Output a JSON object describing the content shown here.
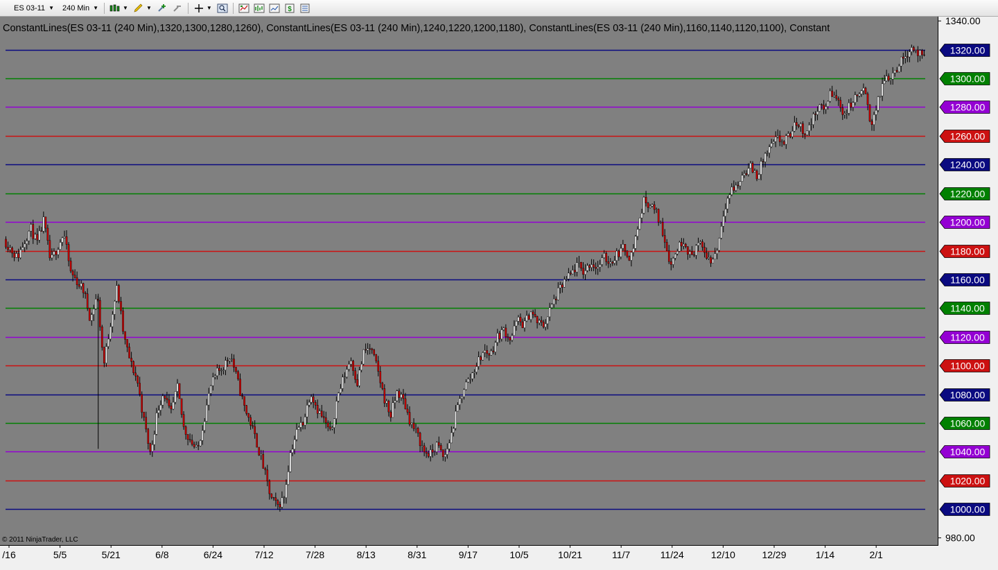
{
  "toolbar": {
    "instrument": "ES 03-11",
    "interval": "240 Min",
    "buttons": [
      {
        "name": "bar-type-icon",
        "dropdown": true
      },
      {
        "name": "draw-pencil-icon",
        "dropdown": true
      },
      {
        "name": "zoom-in-icon",
        "dropdown": false
      },
      {
        "name": "zoom-out-icon",
        "dropdown": false
      },
      {
        "name": "crosshair-icon",
        "dropdown": true
      },
      {
        "name": "magnify-icon",
        "dropdown": false
      },
      {
        "name": "strategies-icon",
        "dropdown": false
      },
      {
        "name": "indicators-icon",
        "dropdown": false
      },
      {
        "name": "data-box-icon",
        "dropdown": false
      },
      {
        "name": "dollar-icon",
        "dropdown": false
      },
      {
        "name": "properties-icon",
        "dropdown": false
      }
    ]
  },
  "chart": {
    "indicator_label": "ConstantLines(ES 03-11 (240 Min),1320,1300,1280,1260), ConstantLines(ES 03-11 (240 Min),1240,1220,1200,1180), ConstantLines(ES 03-11 (240 Min),1160,1140,1120,1100), Constant",
    "copyright": "© 2011 NinjaTrader, LLC",
    "colors": {
      "background": "#808080",
      "axis_background": "#f0f0f0",
      "candle_up": "#f0f0f0",
      "candle_down": "#cc0000",
      "wick": "#000000",
      "navy": "#0a0a80",
      "green": "#008000",
      "purple": "#9400d3",
      "red": "#cc1111"
    }
  },
  "chart_data": {
    "type": "candlestick",
    "title": "",
    "xlabel": "",
    "ylabel": "",
    "ylim": [
      975,
      1343
    ],
    "grid": false,
    "y_ticks_plain": [
      "1340.00",
      "980.00"
    ],
    "x_ticks": [
      "/16",
      "5/5",
      "5/21",
      "6/8",
      "6/24",
      "7/12",
      "7/28",
      "8/13",
      "8/31",
      "9/17",
      "10/5",
      "10/21",
      "11/7",
      "11/24",
      "12/10",
      "12/29",
      "1/14",
      "2/1"
    ],
    "constant_lines": [
      {
        "value": 1320,
        "label": "1320.00",
        "color": "navy"
      },
      {
        "value": 1300,
        "label": "1300.00",
        "color": "green"
      },
      {
        "value": 1280,
        "label": "1280.00",
        "color": "purple"
      },
      {
        "value": 1260,
        "label": "1260.00",
        "color": "red"
      },
      {
        "value": 1240,
        "label": "1240.00",
        "color": "navy"
      },
      {
        "value": 1220,
        "label": "1220.00",
        "color": "green"
      },
      {
        "value": 1200,
        "label": "1200.00",
        "color": "purple"
      },
      {
        "value": 1180,
        "label": "1180.00",
        "color": "red"
      },
      {
        "value": 1160,
        "label": "1160.00",
        "color": "navy"
      },
      {
        "value": 1140,
        "label": "1140.00",
        "color": "green"
      },
      {
        "value": 1120,
        "label": "1120.00",
        "color": "purple"
      },
      {
        "value": 1100,
        "label": "1100.00",
        "color": "red"
      },
      {
        "value": 1080,
        "label": "1080.00",
        "color": "navy"
      },
      {
        "value": 1060,
        "label": "1060.00",
        "color": "green"
      },
      {
        "value": 1040,
        "label": "1040.00",
        "color": "purple"
      },
      {
        "value": 1020,
        "label": "1020.00",
        "color": "red"
      },
      {
        "value": 1000,
        "label": "1000.00",
        "color": "navy"
      }
    ],
    "price_path": [
      [
        0,
        1188
      ],
      [
        2,
        1175
      ],
      [
        4,
        1196
      ],
      [
        5,
        1185
      ],
      [
        6,
        1201
      ],
      [
        7,
        1172
      ],
      [
        9,
        1192
      ],
      [
        10,
        1165
      ],
      [
        12,
        1152
      ],
      [
        13,
        1132
      ],
      [
        14,
        1150
      ],
      [
        15,
        1100
      ],
      [
        16,
        1130
      ],
      [
        17,
        1155
      ],
      [
        18,
        1120
      ],
      [
        19,
        1102
      ],
      [
        20,
        1090
      ],
      [
        21,
        1062
      ],
      [
        22,
        1038
      ],
      [
        23,
        1068
      ],
      [
        24,
        1082
      ],
      [
        25,
        1065
      ],
      [
        26,
        1085
      ],
      [
        27,
        1056
      ],
      [
        28,
        1048
      ],
      [
        29,
        1040
      ],
      [
        30,
        1062
      ],
      [
        31,
        1085
      ],
      [
        32,
        1095
      ],
      [
        33,
        1100
      ],
      [
        34,
        1108
      ],
      [
        35,
        1090
      ],
      [
        36,
        1072
      ],
      [
        37,
        1060
      ],
      [
        38,
        1045
      ],
      [
        39,
        1028
      ],
      [
        40,
        1008
      ],
      [
        41,
        1002
      ],
      [
        42,
        1008
      ],
      [
        43,
        1040
      ],
      [
        44,
        1055
      ],
      [
        45,
        1062
      ],
      [
        46,
        1082
      ],
      [
        47,
        1070
      ],
      [
        48,
        1062
      ],
      [
        49,
        1052
      ],
      [
        50,
        1078
      ],
      [
        51,
        1092
      ],
      [
        52,
        1105
      ],
      [
        53,
        1088
      ],
      [
        54,
        1110
      ],
      [
        55,
        1112
      ],
      [
        56,
        1098
      ],
      [
        57,
        1078
      ],
      [
        58,
        1065
      ],
      [
        59,
        1082
      ],
      [
        60,
        1075
      ],
      [
        61,
        1060
      ],
      [
        62,
        1052
      ],
      [
        63,
        1040
      ],
      [
        64,
        1038
      ],
      [
        65,
        1045
      ],
      [
        66,
        1035
      ],
      [
        67,
        1050
      ],
      [
        68,
        1070
      ],
      [
        69,
        1085
      ],
      [
        70,
        1092
      ],
      [
        71,
        1102
      ],
      [
        72,
        1110
      ],
      [
        73,
        1108
      ],
      [
        74,
        1120
      ],
      [
        75,
        1125
      ],
      [
        76,
        1118
      ],
      [
        77,
        1132
      ],
      [
        78,
        1128
      ],
      [
        79,
        1138
      ],
      [
        80,
        1130
      ],
      [
        81,
        1128
      ],
      [
        82,
        1140
      ],
      [
        83,
        1150
      ],
      [
        84,
        1158
      ],
      [
        85,
        1163
      ],
      [
        86,
        1170
      ],
      [
        87,
        1165
      ],
      [
        88,
        1172
      ],
      [
        89,
        1168
      ],
      [
        90,
        1175
      ],
      [
        91,
        1172
      ],
      [
        92,
        1178
      ],
      [
        93,
        1182
      ],
      [
        94,
        1175
      ],
      [
        95,
        1195
      ],
      [
        96,
        1215
      ],
      [
        97,
        1212
      ],
      [
        98,
        1205
      ],
      [
        99,
        1190
      ],
      [
        100,
        1170
      ],
      [
        101,
        1182
      ],
      [
        102,
        1188
      ],
      [
        103,
        1175
      ],
      [
        104,
        1185
      ],
      [
        105,
        1180
      ],
      [
        106,
        1172
      ],
      [
        107,
        1182
      ],
      [
        108,
        1210
      ],
      [
        109,
        1222
      ],
      [
        110,
        1225
      ],
      [
        111,
        1235
      ],
      [
        112,
        1238
      ],
      [
        113,
        1232
      ],
      [
        114,
        1245
      ],
      [
        115,
        1252
      ],
      [
        116,
        1258
      ],
      [
        117,
        1255
      ],
      [
        118,
        1262
      ],
      [
        119,
        1270
      ],
      [
        120,
        1262
      ],
      [
        121,
        1268
      ],
      [
        122,
        1280
      ],
      [
        123,
        1278
      ],
      [
        124,
        1290
      ],
      [
        125,
        1285
      ],
      [
        126,
        1275
      ],
      [
        127,
        1282
      ],
      [
        128,
        1288
      ],
      [
        129,
        1292
      ],
      [
        130,
        1268
      ],
      [
        131,
        1282
      ],
      [
        132,
        1300
      ],
      [
        133,
        1302
      ],
      [
        134,
        1308
      ],
      [
        135,
        1315
      ],
      [
        136,
        1322
      ],
      [
        137,
        1318
      ],
      [
        138,
        1313
      ]
    ],
    "spike_low": {
      "position": 14,
      "value": 1042
    }
  }
}
